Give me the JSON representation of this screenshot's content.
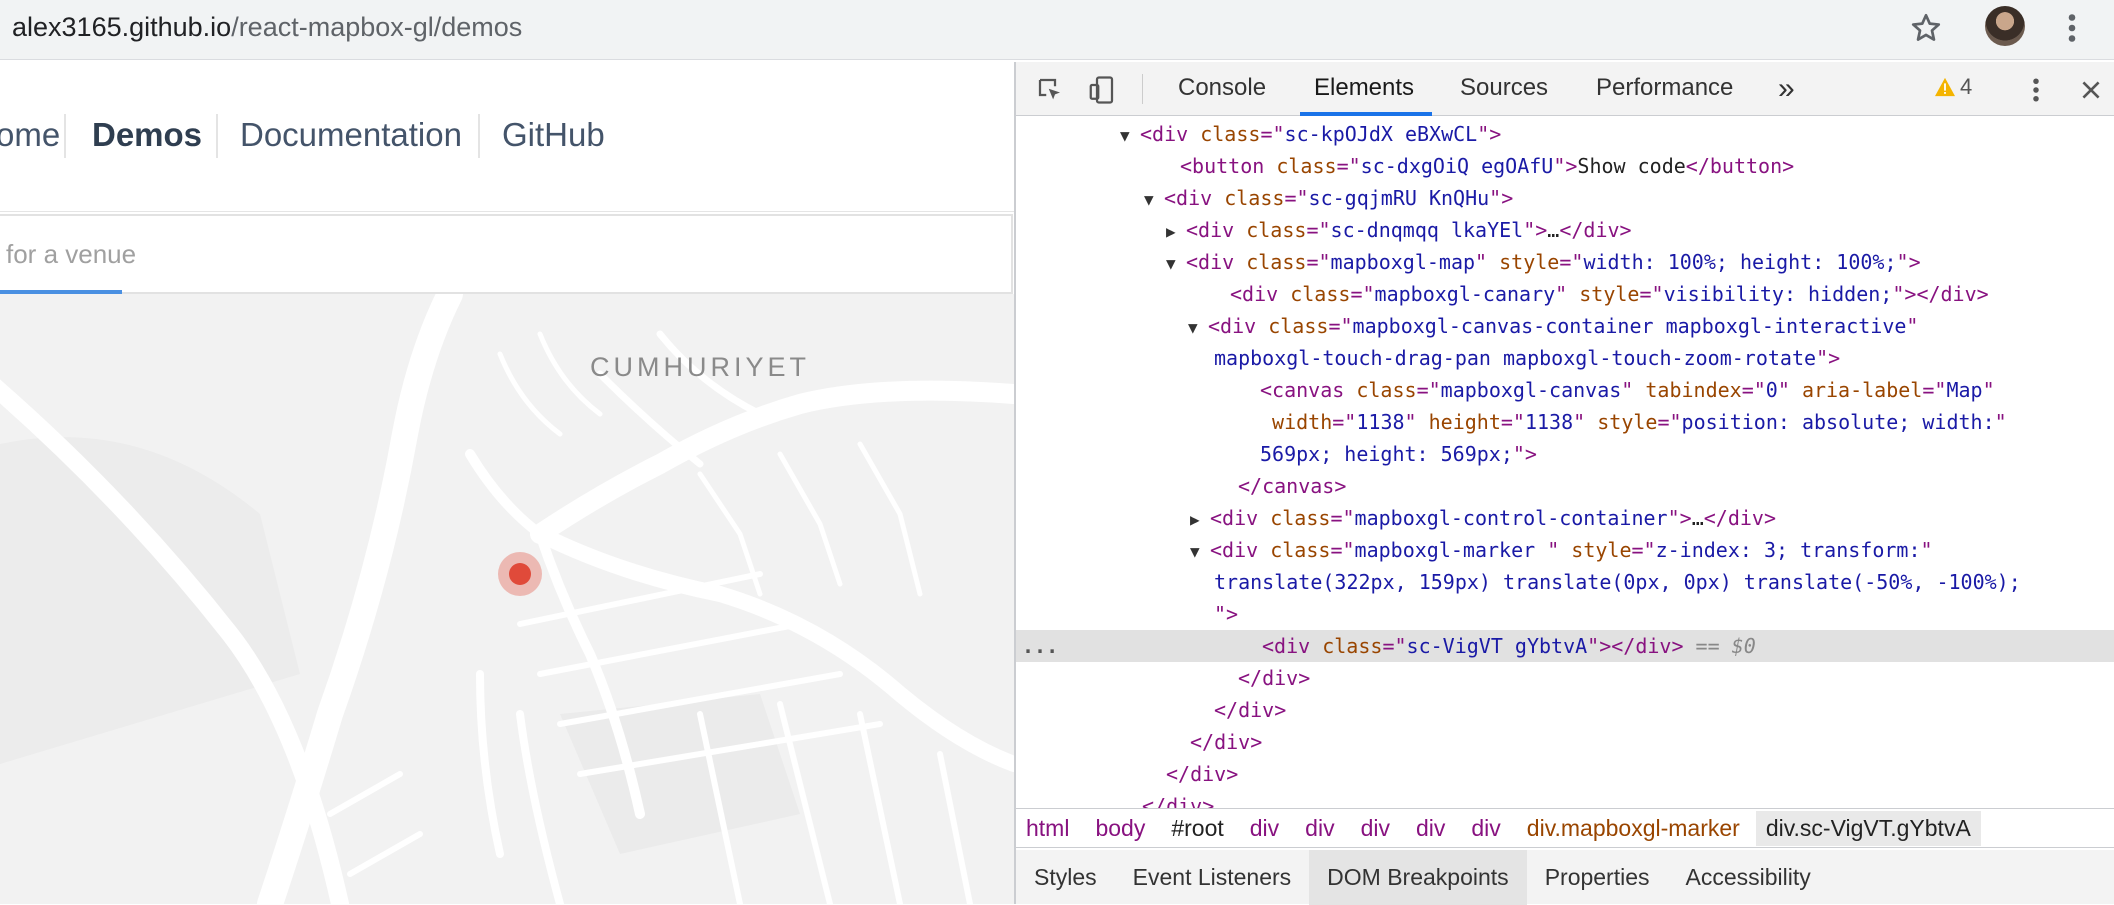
{
  "browser": {
    "url_host": "alex3165.github.io",
    "url_path": "/react-mapbox-gl/demos"
  },
  "site": {
    "nav": [
      "ome",
      "Demos",
      "Documentation",
      "GitHub"
    ],
    "search_placeholder": "for a venue",
    "map_label": "CUMHURIYET"
  },
  "devtools": {
    "tabs": [
      "Console",
      "Elements",
      "Sources",
      "Performance"
    ],
    "active_tab": "Elements",
    "more": "»",
    "warnings": "4",
    "dom": [
      {
        "open": "<",
        "tag": "div",
        "attrs": [
          {
            "n": "class",
            "v": "sc-kpOJdX eBXwCL"
          }
        ],
        "close": ">"
      },
      {
        "open": "<",
        "tag": "button",
        "attrs": [
          {
            "n": "class",
            "v": "sc-dxgOiQ egOAfU"
          }
        ],
        "text": "Show code",
        "endtag": "button"
      },
      {
        "open": "<",
        "tag": "div",
        "attrs": [
          {
            "n": "class",
            "v": "sc-gqjmRU KnQHu"
          }
        ],
        "close": ">"
      },
      {
        "open": "<",
        "tag": "div",
        "attrs": [
          {
            "n": "class",
            "v": "sc-dnqmqq lkaYEl"
          }
        ],
        "text": "…",
        "endtag": "div"
      },
      {
        "open": "<",
        "tag": "div",
        "attrs": [
          {
            "n": "class",
            "v": "mapboxgl-map"
          },
          {
            "n": "style",
            "v": "width: 100%; height: 100%;"
          }
        ],
        "close": ">"
      },
      {
        "open": "<",
        "tag": "div",
        "attrs": [
          {
            "n": "class",
            "v": "mapboxgl-canary"
          },
          {
            "n": "style",
            "v": "visibility: hidden;"
          }
        ],
        "text": "",
        "endtag": "div"
      },
      {
        "open": "<",
        "tag": "div",
        "attrs": [
          {
            "n": "class",
            "v": "mapboxgl-canvas-container mapboxgl-interactive"
          }
        ],
        "close": ""
      },
      {
        "raw_value": "mapboxgl-touch-drag-pan mapboxgl-touch-zoom-rotate",
        "close": ">"
      },
      {
        "open": "<",
        "tag": "canvas",
        "attrs": [
          {
            "n": "class",
            "v": "mapboxgl-canvas"
          },
          {
            "n": "tabindex",
            "v": "0"
          },
          {
            "n": "aria-label",
            "v": "Map"
          }
        ],
        "close": ""
      },
      {
        "attrs": [
          {
            "n": "width",
            "v": "1138"
          },
          {
            "n": "height",
            "v": "1138"
          },
          {
            "n": "style",
            "v": "position: absolute; width:"
          }
        ],
        "close": ""
      },
      {
        "raw_value": "569px; height: 569px;",
        "close": ">"
      },
      {
        "endonly": "canvas"
      },
      {
        "open": "<",
        "tag": "div",
        "attrs": [
          {
            "n": "class",
            "v": "mapboxgl-control-container"
          }
        ],
        "text": "…",
        "endtag": "div"
      },
      {
        "open": "<",
        "tag": "div",
        "attrs": [
          {
            "n": "class",
            "v": "mapboxgl-marker "
          },
          {
            "n": "style",
            "v": "z-index: 3; transform:"
          }
        ],
        "close": ""
      },
      {
        "raw_value": "translate(322px, 159px) translate(0px, 0px) translate(-50%, -100%);",
        "close": ""
      },
      {
        "raw_value": "",
        "close": ">"
      },
      {
        "open": "<",
        "tag": "div",
        "attrs": [
          {
            "n": "class",
            "v": "sc-VigVT gYbtvA"
          }
        ],
        "text": "",
        "endtag": "div",
        "suffix": " == $0"
      },
      {
        "endonly": "div"
      },
      {
        "endonly": "div"
      },
      {
        "endonly": "div"
      },
      {
        "endonly": "div"
      },
      {
        "endonly": "div"
      }
    ],
    "breadcrumbs": [
      "html",
      "body",
      "#root",
      "div",
      "div",
      "div",
      "div",
      "div",
      "div.mapboxgl-marker",
      "div.sc-VigVT.gYbtvA"
    ],
    "subtabs": [
      "Styles",
      "Event Listeners",
      "DOM Breakpoints",
      "Properties",
      "Accessibility"
    ],
    "active_subtab": "DOM Breakpoints"
  }
}
